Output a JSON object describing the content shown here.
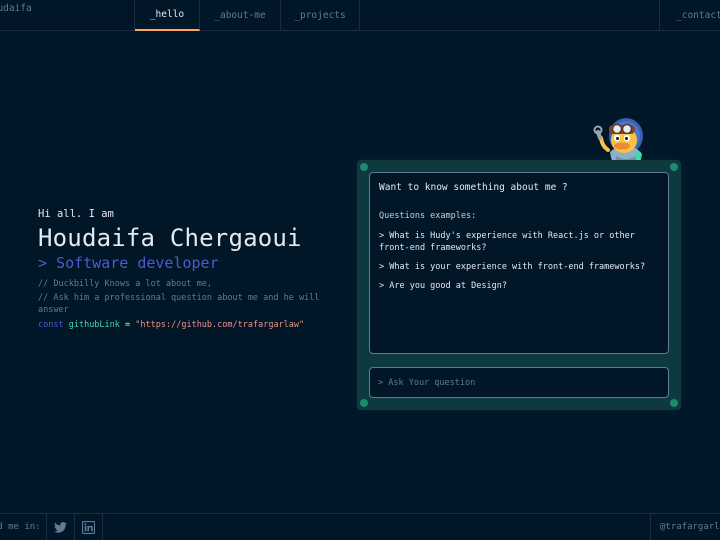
{
  "header": {
    "brand": "houdaifa",
    "tabs": [
      {
        "label": "_hello",
        "active": true
      },
      {
        "label": "_about-me",
        "active": false
      },
      {
        "label": "_projects",
        "active": false
      }
    ],
    "contact": "_contact-me"
  },
  "hero": {
    "greeting": "Hi all. I am",
    "name": "Houdaifa Chergaoui",
    "role": "> Software developer",
    "comments": [
      "// Duckbilly Knows a lot about me,",
      "// Ask him a professional question about me and he will answer"
    ],
    "code": {
      "keyword": "const",
      "variable": "githubLink",
      "equals": "=",
      "value": "\"https://github.com/trafargarlaw\""
    }
  },
  "chat": {
    "title": "Want to know something about me ?",
    "subtitle": "Questions examples:",
    "questions": [
      "> What is Hudy's experience with React.js or other front-end frameworks?",
      "> What is your experience with front-end frameworks?",
      "> Are you good at Design?"
    ],
    "input_placeholder": "> Ask Your question",
    "input_value": ""
  },
  "footer": {
    "find_label": "find me in:",
    "socials": [
      "twitter-icon",
      "linkedin-icon"
    ],
    "handle": "@trafargarlaw"
  },
  "colors": {
    "background": "#011627",
    "accent_orange": "#fea55f",
    "accent_purple": "#4d5bce",
    "accent_green": "#43d9ad",
    "string": "#e99287",
    "panel": "#0e3a3f"
  }
}
